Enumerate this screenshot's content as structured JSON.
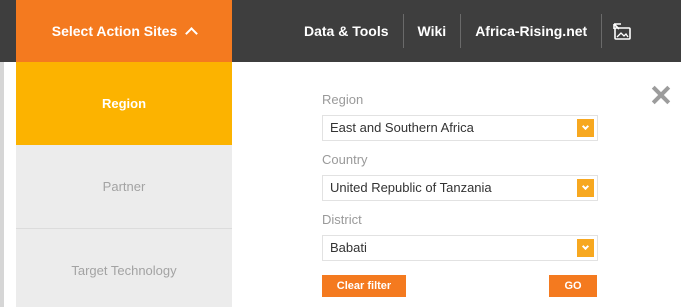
{
  "header": {
    "select_label": "Select Action Sites",
    "nav": [
      "Data & Tools",
      "Wiki",
      "Africa-Rising.net"
    ]
  },
  "sidebar": {
    "items": [
      {
        "label": "Region",
        "active": true
      },
      {
        "label": "Partner",
        "active": false
      },
      {
        "label": "Target Technology",
        "active": false
      }
    ]
  },
  "filter": {
    "region_label": "Region",
    "region_value": "East and Southern Africa",
    "country_label": "Country",
    "country_value": "United Republic of Tanzania",
    "district_label": "District",
    "district_value": "Babati",
    "clear_label": "Clear filter",
    "go_label": "GO"
  },
  "icons": {
    "toggle": "chevron-up-icon",
    "fullscreen": "screen-icon",
    "close": "close-icon"
  },
  "colors": {
    "accent": "#f47a1f",
    "active": "#fcb300",
    "topbar": "#3e3e3e"
  }
}
